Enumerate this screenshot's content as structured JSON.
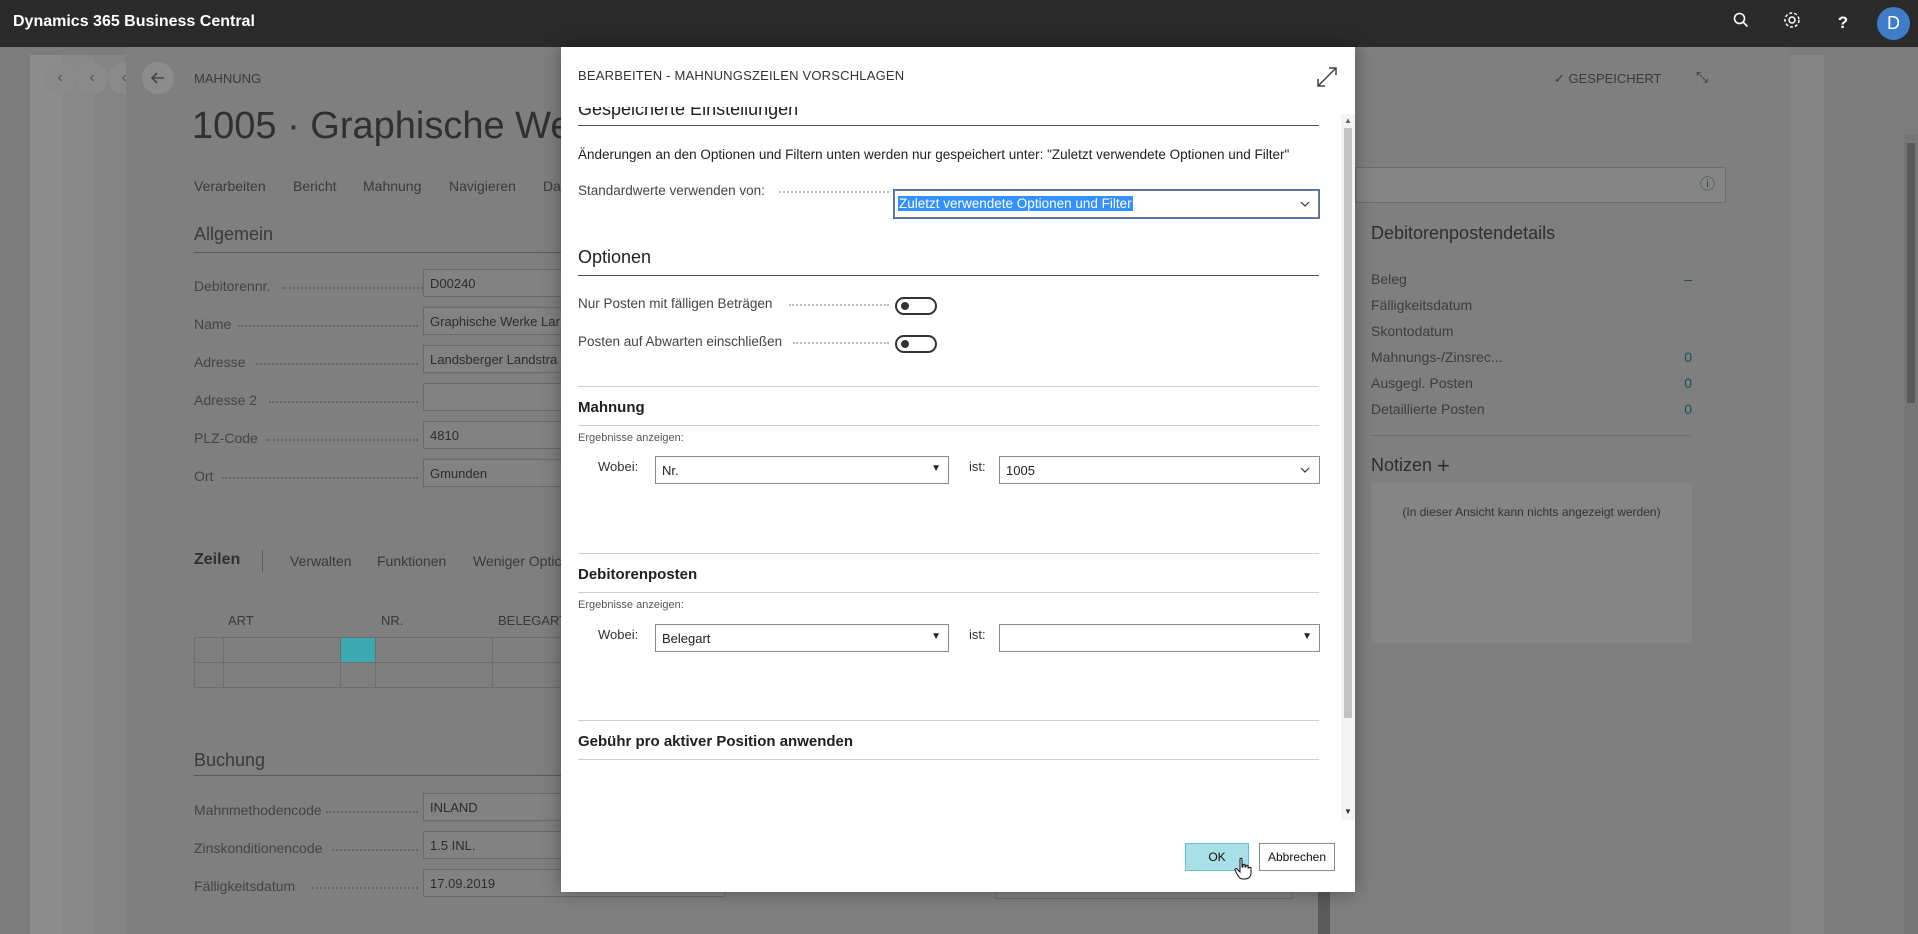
{
  "app": {
    "title": "Dynamics 365 Business Central",
    "avatar_initial": "D"
  },
  "page": {
    "type_label": "MAHNUNG",
    "title": "1005 · Graphische Wer",
    "saved_label": "GESPEICHERT",
    "menu": [
      "Verarbeiten",
      "Bericht",
      "Mahnung",
      "Navigieren",
      "Da"
    ],
    "general": {
      "heading": "Allgemein",
      "fields": [
        {
          "label": "Debitorennr.",
          "value": "D00240"
        },
        {
          "label": "Name",
          "value": "Graphische Werke Lar"
        },
        {
          "label": "Adresse",
          "value": "Landsberger Landstra"
        },
        {
          "label": "Adresse 2",
          "value": ""
        },
        {
          "label": "PLZ-Code",
          "value": "4810"
        },
        {
          "label": "Ort",
          "value": "Gmunden"
        }
      ]
    },
    "lines": {
      "tab": "Zeilen",
      "actions": [
        "Verwalten",
        "Funktionen",
        "Weniger Optic"
      ],
      "columns": [
        "ART",
        "NR.",
        "BELEGART"
      ]
    },
    "posting": {
      "heading": "Buchung",
      "fields": [
        {
          "label": "Mahnmethodencode",
          "value": "INLAND"
        },
        {
          "label": "Zinskonditionencode",
          "value": "1.5 INL."
        },
        {
          "label": "Fälligkeitsdatum",
          "value": "17.09.2019"
        }
      ]
    }
  },
  "factbox": {
    "title": "Debitorenpostendetails",
    "rows": [
      {
        "label": "Beleg",
        "value": "–"
      },
      {
        "label": "Fälligkeitsdatum",
        "value": ""
      },
      {
        "label": "Skontodatum",
        "value": ""
      },
      {
        "label": "Mahnungs-/Zinsrec...",
        "value": "0"
      },
      {
        "label": "Ausgegl. Posten",
        "value": "0"
      },
      {
        "label": "Detaillierte Posten",
        "value": "0"
      }
    ],
    "notes_title": "Notizen",
    "notes_empty": "(In dieser Ansicht kann nichts angezeigt werden)"
  },
  "dialog": {
    "title": "BEARBEITEN - MAHNUNGSZEILEN VORSCHLAGEN",
    "saved_settings": {
      "heading": "Gespeicherte Einstellungen",
      "info": "Änderungen an den Optionen und Filtern unten werden nur gespeichert unter: \"Zuletzt verwendete Optionen und Filter\"",
      "defaults_label": "Standardwerte verwenden von:",
      "defaults_value": "Zuletzt verwendete Optionen und Filter"
    },
    "options": {
      "heading": "Optionen",
      "toggles": [
        {
          "label": "Nur Posten mit fälligen Beträgen",
          "on": false
        },
        {
          "label": "Posten auf Abwarten einschließen",
          "on": false
        }
      ]
    },
    "reminder_filter": {
      "heading": "Mahnung",
      "show_results": "Ergebnisse anzeigen:",
      "where_label": "Wobei:",
      "field": "Nr.",
      "is_label": "ist:",
      "value": "1005"
    },
    "cust_entries_filter": {
      "heading": "Debitorenposten",
      "show_results": "Ergebnisse anzeigen:",
      "where_label": "Wobei:",
      "field": "Belegart",
      "is_label": "ist:",
      "value": ""
    },
    "fee_section": {
      "heading": "Gebühr pro aktiver Position anwenden"
    },
    "ok_label": "OK",
    "cancel_label": "Abbrechen"
  }
}
